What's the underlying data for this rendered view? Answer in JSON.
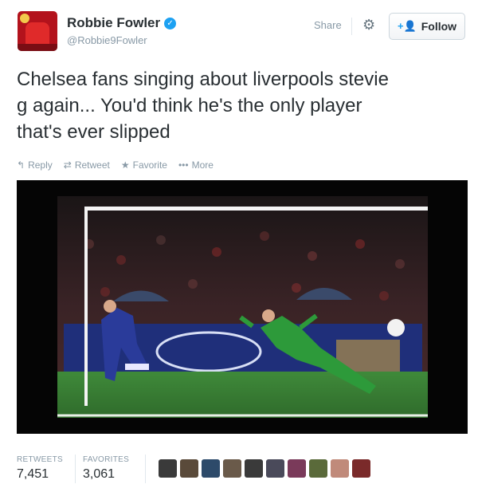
{
  "user": {
    "display_name": "Robbie Fowler",
    "handle": "@Robbie9Fowler",
    "verified_icon": "verified-badge-icon"
  },
  "header": {
    "share_label": "Share",
    "follow_label": "Follow"
  },
  "tweet": {
    "lines": [
      "Chelsea fans singing about liverpools stevie",
      "g again... You'd think he's the only player",
      "that's ever slipped"
    ]
  },
  "actions": {
    "reply": "Reply",
    "retweet": "Retweet",
    "favorite": "Favorite",
    "more": "More"
  },
  "stats": {
    "retweets_label": "RETWEETS",
    "retweets_value": "7,451",
    "favorites_label": "FAVORITES",
    "favorites_value": "3,061"
  },
  "colors": {
    "accent": "#1da1f2",
    "text": "#292f33",
    "muted": "#8899a6"
  },
  "favoriter_avatars": [
    "#3a3a3a",
    "#5a4a3a",
    "#2d4a6a",
    "#6a5a4a",
    "#3a3a3a",
    "#4a4a5a",
    "#7a3a5a",
    "#5a6a3a",
    "#c08a7a",
    "#7a2a2a"
  ]
}
